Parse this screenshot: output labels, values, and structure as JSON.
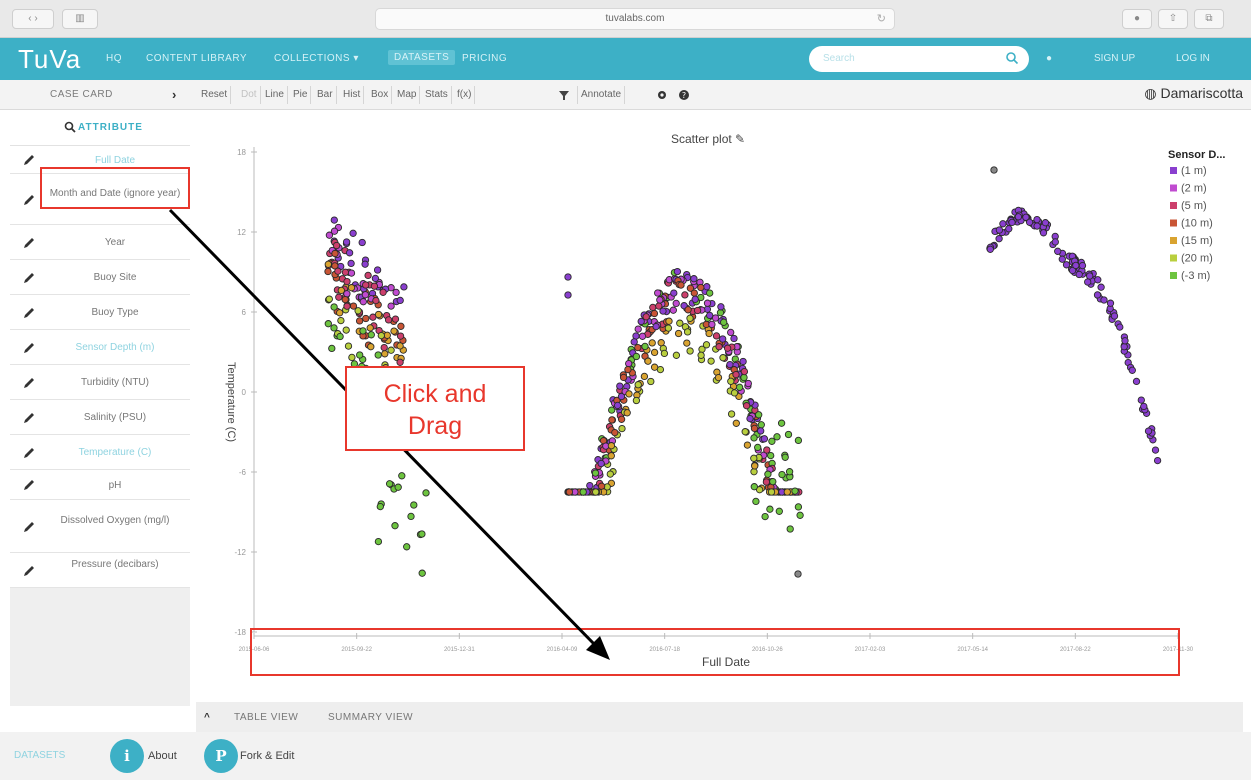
{
  "browser": {
    "url": "tuvalabs.com"
  },
  "nav": {
    "logo": "TuVa",
    "items": [
      "HQ",
      "CONTENT LIBRARY",
      "COLLECTIONS ▾",
      "DATASETS",
      "PRICING"
    ],
    "search_placeholder": "Search",
    "right_items": [
      "SIGN UP",
      "LOG IN"
    ]
  },
  "toolbar": {
    "case_card": "CASE CARD",
    "buttons": [
      "Reset",
      "Dot",
      "Line",
      "Pie",
      "Bar",
      "Hist",
      "Box",
      "Map",
      "Stats",
      "f(x)"
    ],
    "annotate": "Annotate",
    "place": "Damariscotta"
  },
  "sidebar": {
    "header": "ATTRIBUTE",
    "items": [
      {
        "label": "Full Date"
      },
      {
        "label": "Month and Date (ignore year)"
      },
      {
        "label": "Year"
      },
      {
        "label": "Buoy Site"
      },
      {
        "label": "Buoy Type"
      },
      {
        "label": "Sensor Depth (m)"
      },
      {
        "label": "Turbidity (NTU)"
      },
      {
        "label": "Salinity (PSU)"
      },
      {
        "label": "Temperature (C)"
      },
      {
        "label": "pH"
      },
      {
        "label": "Dissolved Oxygen (mg/l)"
      },
      {
        "label": "Pressure (decibars)"
      }
    ]
  },
  "chart_data": {
    "type": "scatter",
    "title": "Scatter plot",
    "xlabel": "Full Date",
    "ylabel": "Temperature (C)",
    "y_ticks": [
      "18",
      "12",
      "6",
      "0",
      "-6",
      "-12",
      "-18"
    ],
    "x_ticks": [
      "2015-06-06",
      "2015-09-22",
      "2015-12-31",
      "2016-04-09",
      "2016-07-18",
      "2016-10-26",
      "2017-02-03",
      "2017-05-14",
      "2017-08-22",
      "2017-11-30"
    ],
    "legend_title": "Sensor D...",
    "legend_position": "top-right",
    "series": [
      {
        "name": "(1 m)",
        "color": "#8a3fcf"
      },
      {
        "name": "(2 m)",
        "color": "#c04bd0"
      },
      {
        "name": "(5 m)",
        "color": "#cc3f6c"
      },
      {
        "name": "(10 m)",
        "color": "#c95535"
      },
      {
        "name": "(15 m)",
        "color": "#d9a330"
      },
      {
        "name": "(20 m)",
        "color": "#b9cf3e"
      },
      {
        "name": "(-3 m)",
        "color": "#6dc43f"
      }
    ]
  },
  "annotation": {
    "callout": [
      "Click and",
      "Drag"
    ]
  },
  "bottom": {
    "table_view": "TABLE VIEW",
    "summary_view": "SUMMARY VIEW"
  },
  "footer": {
    "left": "DATASETS",
    "about_icon": "i",
    "about": "About",
    "fork_icon": "P",
    "fork": "Fork & Edit"
  }
}
